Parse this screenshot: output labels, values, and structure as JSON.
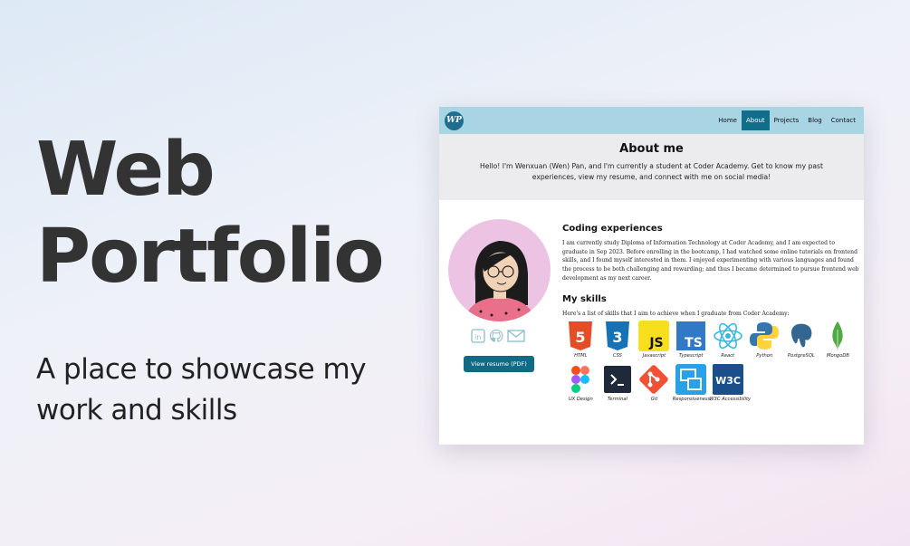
{
  "hero": {
    "title_line1": "Web",
    "title_line2": "Portfolio",
    "subtitle": "A place to showcase my work and skills"
  },
  "site": {
    "logo_text": "WP",
    "nav": [
      "Home",
      "About",
      "Projects",
      "Blog",
      "Contact"
    ],
    "active_nav": "About",
    "about_title": "About me",
    "about_text": "Hello! I'm Wenxuan (Wen) Pan, and I'm currently a student at Coder Academy. Get to know my past experiences, view my resume, and connect with me on social media!",
    "resume_label": "View resume (PDF)",
    "coding_title": "Coding experiences",
    "coding_text": "I am currently study Diploma of Information Technology at Coder Academy, and I am expected to graduate in Sep 2023. Before enrolling in the bootcamp, I had watched some online tutorials on frontend skills, and I found myself interested in them. I enjoyed experimenting with various languages and found the process to be both challenging and rewarding; and thus I became determined to pursue frontend web development as my next career.",
    "skills_title": "My skills",
    "skills_intro": "Here's a list of skills that I aim to achieve when I graduate from Coder Academy:",
    "skills_row1": [
      "HTML",
      "CSS",
      "Javascript",
      "Typescript",
      "React",
      "Python",
      "PostgreSQL",
      "MongoDB"
    ],
    "skills_row2": [
      "UX Design",
      "Terminal",
      "Git",
      "Responsiveness",
      "W3C Accessibility"
    ],
    "social_icons": [
      "linkedin-icon",
      "github-icon",
      "mail-icon"
    ]
  },
  "colors": {
    "nav_bg": "#a8d4e4",
    "accent": "#0f6e8c",
    "avatar_bg": "#ecc3e3"
  }
}
